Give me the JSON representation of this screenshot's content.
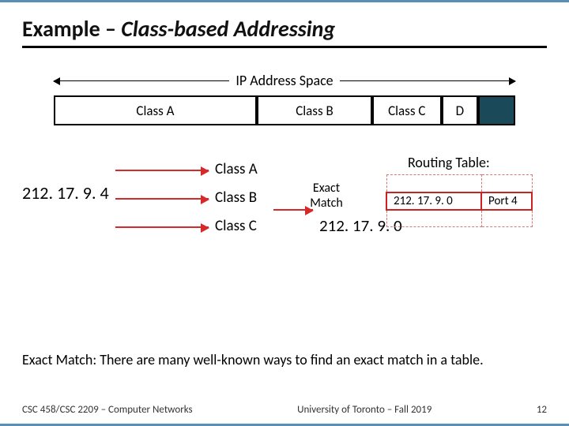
{
  "title_pre": "Example – ",
  "title_em": "Class-based Addressing",
  "ip_label": "IP Address Space",
  "classbar": {
    "a": "Class A",
    "b": "Class B",
    "c": "Class C",
    "d": "D",
    "e": ""
  },
  "input_ip": "212. 17. 9. 4",
  "labels": {
    "a": "Class A",
    "b": "Class B",
    "c": "Class C"
  },
  "exact_match": "Exact\nMatch",
  "rhs_ip": "212. 17. 9. 0",
  "routing_table_label": "Routing Table:",
  "routing_table": {
    "row1": {
      "prefix": "",
      "port": ""
    },
    "row2": {
      "prefix": "212. 17. 9. 0",
      "port": "Port 4"
    },
    "row3": {
      "prefix": "",
      "port": ""
    }
  },
  "caption": "Exact Match: There are many well-known ways to find an exact match in a table.",
  "footer_left": "CSC 458/CSC 2209 – Computer Networks",
  "footer_center": "University of Toronto – Fall 2019",
  "footer_right": "12"
}
